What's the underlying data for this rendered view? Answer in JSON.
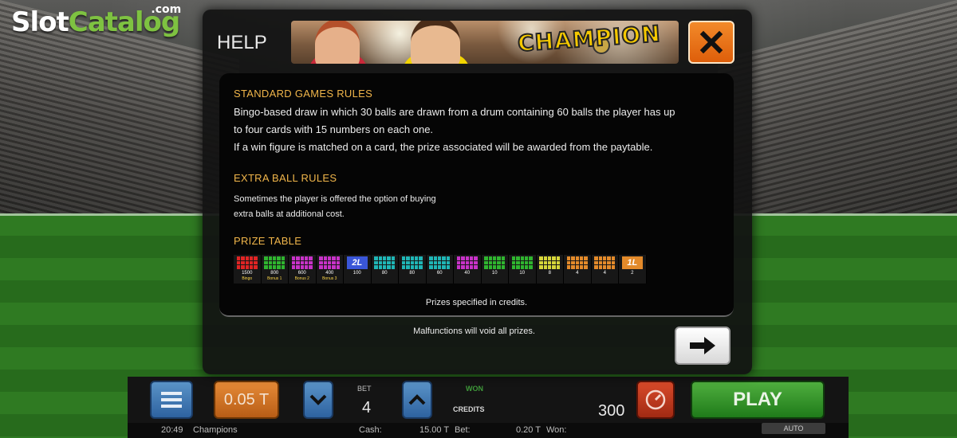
{
  "watermark": {
    "slot": "Slot",
    "catalog": "Catalog",
    "com": ".com"
  },
  "dialog": {
    "title": "HELP",
    "banner_text": "CHAMPION",
    "standard_rules": {
      "title": "STANDARD GAMES RULES",
      "line1": "Bingo-based draw in which 30 balls are drawn from a drum containing 60 balls the player has up",
      "line2": "to four cards with 15 numbers on each one.",
      "line3": "If a win figure is matched on a card, the prize associated will be awarded from the paytable."
    },
    "extra_ball": {
      "title": "EXTRA BALL RULES",
      "line1": "Sometimes the player is offered the option of buying",
      "line2": "extra balls at additional cost."
    },
    "prize_table": {
      "title": "PRIZE TABLE",
      "prizes": [
        {
          "value": "1500",
          "label": "Bingo",
          "color": "#e02424",
          "special": ""
        },
        {
          "value": "800",
          "label": "Bonus 1",
          "color": "#2fb52f",
          "special": ""
        },
        {
          "value": "600",
          "label": "Bonus 2",
          "color": "#c832c8",
          "special": ""
        },
        {
          "value": "400",
          "label": "Bonus 3",
          "color": "#c832c8",
          "special": ""
        },
        {
          "value": "100",
          "label": "",
          "color": "#3a56d8",
          "special": "2L"
        },
        {
          "value": "80",
          "label": "",
          "color": "#1fb6b6",
          "special": ""
        },
        {
          "value": "80",
          "label": "",
          "color": "#1fb6b6",
          "special": ""
        },
        {
          "value": "60",
          "label": "",
          "color": "#1fb6b6",
          "special": ""
        },
        {
          "value": "40",
          "label": "",
          "color": "#c832c8",
          "special": ""
        },
        {
          "value": "10",
          "label": "",
          "color": "#2fb52f",
          "special": ""
        },
        {
          "value": "10",
          "label": "",
          "color": "#2fb52f",
          "special": ""
        },
        {
          "value": "8",
          "label": "",
          "color": "#d6d63a",
          "special": ""
        },
        {
          "value": "4",
          "label": "",
          "color": "#e38a2a",
          "special": ""
        },
        {
          "value": "4",
          "label": "",
          "color": "#e38a2a",
          "special": ""
        },
        {
          "value": "2",
          "label": "",
          "color": "#e38a2a",
          "special": "1L"
        }
      ],
      "note": "Prizes specified in credits."
    },
    "malfunctions": "Malfunctions will void all prizes.",
    "icons": {
      "close": "close-icon",
      "next": "arrow-right-icon"
    }
  },
  "controls": {
    "bet_value": "0.05 T",
    "bet_label": "BET",
    "bet": "4",
    "won_label": "WON",
    "credits_label": "CREDITS",
    "credits": "300",
    "play": "PLAY",
    "auto": "AUTO"
  },
  "status": {
    "time": "20:49",
    "game": "Champions",
    "cash_label": "Cash:",
    "cash": "15.00 T",
    "bet_label": "Bet:",
    "bet": "0.20 T",
    "won_label": "Won:"
  }
}
